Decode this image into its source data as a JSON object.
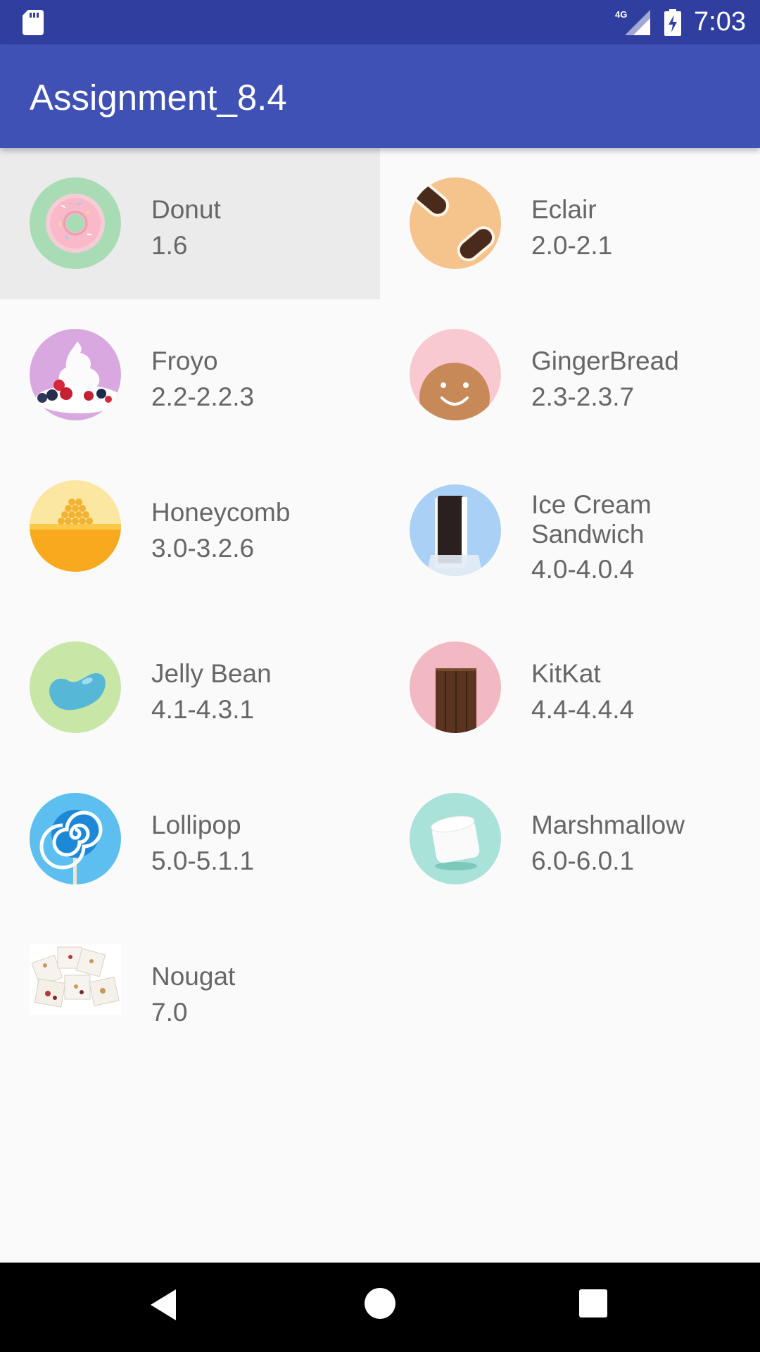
{
  "status_bar": {
    "time": "7:03",
    "network": "4G"
  },
  "app_bar": {
    "title": "Assignment_8.4"
  },
  "items": [
    {
      "name": "Donut",
      "version": "1.6",
      "icon": "donut-icon",
      "selected": true
    },
    {
      "name": "Eclair",
      "version": "2.0-2.1",
      "icon": "eclair-icon"
    },
    {
      "name": "Froyo",
      "version": "2.2-2.2.3",
      "icon": "froyo-icon"
    },
    {
      "name": "GingerBread",
      "version": "2.3-2.3.7",
      "icon": "gingerbread-icon"
    },
    {
      "name": "Honeycomb",
      "version": "3.0-3.2.6",
      "icon": "honeycomb-icon"
    },
    {
      "name": "Ice Cream Sandwich",
      "version": "4.0-4.0.4",
      "icon": "ice-cream-sandwich-icon"
    },
    {
      "name": "Jelly Bean",
      "version": "4.1-4.3.1",
      "icon": "jelly-bean-icon"
    },
    {
      "name": "KitKat",
      "version": "4.4-4.4.4",
      "icon": "kitkat-icon"
    },
    {
      "name": "Lollipop",
      "version": "5.0-5.1.1",
      "icon": "lollipop-icon"
    },
    {
      "name": "Marshmallow",
      "version": "6.0-6.0.1",
      "icon": "marshmallow-icon"
    },
    {
      "name": "Nougat",
      "version": "7.0",
      "icon": "nougat-icon"
    }
  ],
  "colors": {
    "status_bar": "#303f9f",
    "app_bar": "#3f51b5",
    "background": "#fafafa",
    "selected_row": "#ebebeb",
    "text": "#666666"
  }
}
